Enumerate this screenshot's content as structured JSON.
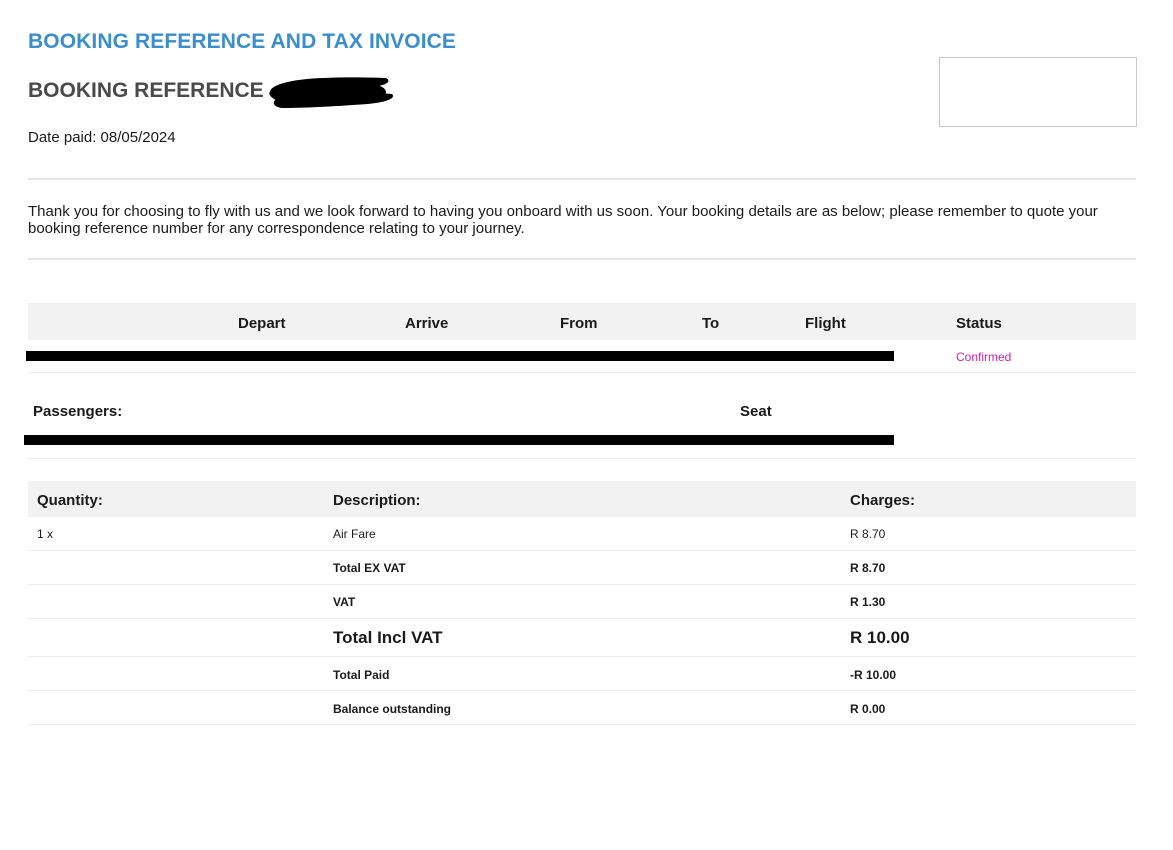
{
  "header": {
    "title": "BOOKING REFERENCE AND TAX INVOICE",
    "reference_label": "BOOKING REFERENCE",
    "date_paid": "Date paid: 08/05/2024"
  },
  "intro_text": "Thank you for choosing to fly with us and we look forward to having you onboard with us soon. Your booking details are as below; please remember to quote your booking reference number for any correspondence relating to your journey.",
  "flight_table": {
    "columns": [
      "Depart",
      "Arrive",
      "From",
      "To",
      "Flight",
      "Status"
    ],
    "status": "Confirmed",
    "status_color": "#cc22aa"
  },
  "passengers": {
    "label": "Passengers:",
    "seat_label": "Seat"
  },
  "charges": {
    "headers": {
      "quantity": "Quantity:",
      "description": "Description:",
      "charges": "Charges:"
    },
    "rows": [
      {
        "quantity": "1 x",
        "description": "Air Fare",
        "charge": "R 8.70"
      },
      {
        "quantity": "",
        "description": "Total EX VAT",
        "charge": "R 8.70"
      },
      {
        "quantity": "",
        "description": "VAT",
        "charge": "R 1.30"
      },
      {
        "quantity": "",
        "description": "Total Incl VAT",
        "charge": "R 10.00"
      },
      {
        "quantity": "",
        "description": "Total Paid",
        "charge": "-R 10.00"
      },
      {
        "quantity": "",
        "description": "Balance outstanding",
        "charge": "R 0.00"
      }
    ]
  },
  "colors": {
    "title": "#3b8ec9",
    "header_band": "#f2f2f2"
  }
}
